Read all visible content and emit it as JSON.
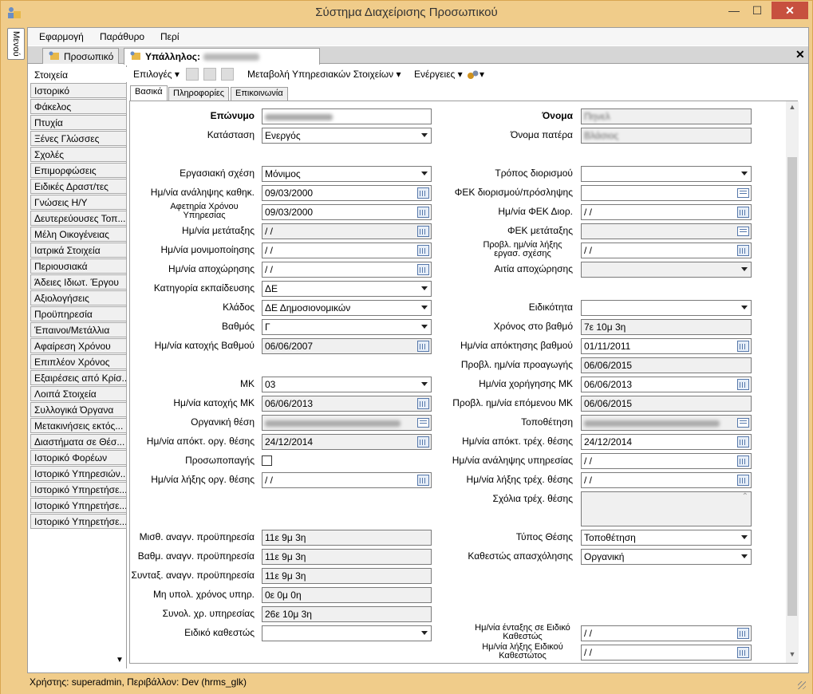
{
  "window": {
    "title": "Σύστημα Διαχείρισης Προσωπικού",
    "minimize": "—",
    "maximize": "☐",
    "close": "✕",
    "side_tab": "Μενού"
  },
  "menu": {
    "items": [
      "Εφαρμογή",
      "Παράθυρο",
      "Περί"
    ]
  },
  "doc_tabs": {
    "tab1": "Προσωπικό",
    "tab2_prefix": "Υπάλληλος:",
    "close": "✕"
  },
  "sidebar": {
    "items": [
      "Στοιχεία",
      "Ιστορικό",
      "Φάκελος",
      "Πτυχία",
      "Ξένες Γλώσσες",
      "Σχολές",
      "Επιμορφώσεις",
      "Ειδικές Δραστ/τες",
      "Γνώσεις Η/Υ",
      "Δευτερεύουσες Τοπ...",
      "Μέλη Οικογένειας",
      "Ιατρικά Στοιχεία",
      "Περιουσιακά",
      "Άδειες Ιδιωτ. Έργου",
      "Αξιολογήσεις",
      "Προϋπηρεσία",
      "Έπαινοι/Μετάλλια",
      "Αφαίρεση Χρόνου",
      "Επιπλέον Χρόνος",
      "Εξαιρέσεις από Κρίσ...",
      "Λοιπά Στοιχεία",
      "Συλλογικά Όργανα",
      "Μετακινήσεις εκτός...",
      "Διαστήματα σε Θέσ...",
      "Ιστορικό Φορέων",
      "Ιστορικό Υπηρεσιών...",
      "Ιστορικό Υπηρετήσε...",
      "Ιστορικό Υπηρετήσε...",
      "Ιστορικό Υπηρετήσε..."
    ],
    "scroll_down": "▼"
  },
  "toolbar": {
    "options": "Επιλογές ▾",
    "change": "Μεταβολή Υπηρεσιακών Στοιχείων ▾",
    "actions": "Ενέργειες ▾",
    "tools": "▾"
  },
  "subtabs": [
    "Βασικά",
    "Πληροφορίες",
    "Επικοινωνία"
  ],
  "form": {
    "surname_label": "Επώνυμο",
    "name_label": "Όνομα",
    "name_value": "Πηνελ",
    "status_label": "Κατάσταση",
    "status_value": "Ενεργός",
    "father_label": "Όνομα πατέρα",
    "father_value": "Βλάσιος",
    "relation_label": "Εργασιακή σχέση",
    "relation_value": "Μόνιμος",
    "appoint_mode_label": "Τρόπος διορισμού",
    "appoint_mode_value": "",
    "hire_date_label": "Ημ/νία ανάληψης καθηκ.",
    "hire_date_value": "09/03/2000",
    "fek_appoint_label": "ΦΕΚ διορισμού/πρόσληψης",
    "fek_appoint_value": "",
    "service_start_label": "Αφετηρία Χρόνου Υπηρεσίας",
    "service_start_value": "09/03/2000",
    "fek_date_label": "Ημ/νία ΦΕΚ Διορ.",
    "fek_date_value": " / /",
    "transfer_date_label": "Ημ/νία μετάταξης",
    "transfer_date_value": " / /",
    "fek_transfer_label": "ΦΕΚ μετάταξης",
    "fek_transfer_value": "",
    "permanent_date_label": "Ημ/νία μονιμοποίησης",
    "permanent_date_value": " / /",
    "expected_end_label": "Προβλ. ημ/νία λήξης εργασ. σχέσης",
    "expected_end_value": " / /",
    "leave_date_label": "Ημ/νία αποχώρησης",
    "leave_date_value": " / /",
    "leave_reason_label": "Αιτία αποχώρησης",
    "leave_reason_value": "",
    "edu_cat_label": "Κατηγορία εκπαίδευσης",
    "edu_cat_value": "ΔΕ",
    "branch_label": "Κλάδος",
    "branch_value": "ΔΕ Δημοσιονομικών",
    "specialty_label": "Ειδικότητα",
    "specialty_value": "",
    "grade_label": "Βαθμός",
    "grade_value": "Γ",
    "grade_time_label": "Χρόνος στο βαθμό",
    "grade_time_value": " 7ε 10μ  3η",
    "grade_hold_label": "Ημ/νία κατοχής Βαθμού",
    "grade_hold_value": "06/06/2007",
    "grade_acq_label": "Ημ/νία απόκτησης βαθμού",
    "grade_acq_value": "01/11/2011",
    "promo_label": "Προβλ. ημ/νία προαγωγής",
    "promo_value": "06/06/2015",
    "mk_label": "ΜΚ",
    "mk_value": "03",
    "mk_grant_label": "Ημ/νία χορήγησης ΜΚ",
    "mk_grant_value": "06/06/2013",
    "mk_hold_label": "Ημ/νία κατοχής ΜΚ",
    "mk_hold_value": "06/06/2013",
    "mk_next_label": "Προβλ. ημ/νία επόμενου ΜΚ",
    "mk_next_value": "06/06/2015",
    "org_pos_label": "Οργανική θέση",
    "placement_label": "Τοποθέτηση",
    "org_acq_label": "Ημ/νία απόκτ. οργ. θέσης",
    "org_acq_value": "24/12/2014",
    "cur_acq_label": "Ημ/νία απόκτ. τρέχ. θέσης",
    "cur_acq_value": "24/12/2014",
    "personal_label": "Προσωποπαγής",
    "service_assume_label": "Ημ/νία ανάληψης υπηρεσίας",
    "service_assume_value": " / /",
    "org_end_label": "Ημ/νία λήξης οργ. θέσης",
    "org_end_value": " / /",
    "cur_end_label": "Ημ/νία λήξης τρέχ. θέσης",
    "cur_end_value": " / /",
    "comments_label": "Σχόλια τρέχ. θέσης",
    "comments_value": "",
    "salary_prev_label": "Μισθ. αναγν. προϋπηρεσία",
    "salary_prev_value": "11ε  9μ  3η",
    "pos_type_label": "Τύπος Θέσης",
    "pos_type_value": "Τοποθέτηση",
    "grade_prev_label": "Βαθμ. αναγν. προϋπηρεσία",
    "grade_prev_value": "11ε  9μ  3η",
    "employ_status_label": "Καθεστώς απασχόλησης",
    "employ_status_value": "Οργανική",
    "pension_prev_label": "Συνταξ. αναγν. προϋπηρεσία",
    "pension_prev_value": "11ε  9μ  3η",
    "nonc_label": "Μη υπολ. χρόνος υπηρ.",
    "nonc_value": " 0ε  0μ  0η",
    "total_label": "Συνολ. χρ. υπηρεσίας",
    "total_value": "26ε 10μ  3η",
    "special_label": "Ειδικό καθεστώς",
    "special_value": "",
    "special_in_label": "Ημ/νία ένταξης σε Ειδικό Καθεστώς",
    "special_in_value": " / /",
    "special_end_label": "Ημ/νία λήξης Ειδικού Καθεστώτος",
    "special_end_value": " / /"
  },
  "status": {
    "text": "Χρήστης: superadmin, Περιβάλλον: Dev (hrms_glk)"
  }
}
